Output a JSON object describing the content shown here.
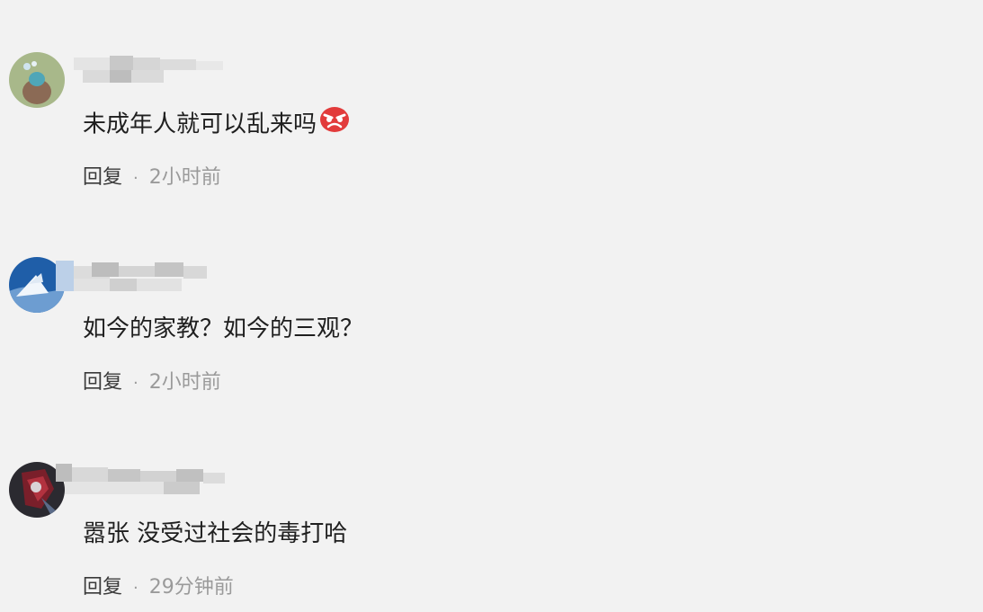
{
  "comments": [
    {
      "text": "未成年人就可以乱来吗",
      "emoji": "angry-face-emoji",
      "reply_label": "回复",
      "separator": "·",
      "time": "2小时前"
    },
    {
      "text": "如今的家教？如今的三观？",
      "reply_label": "回复",
      "separator": "·",
      "time": "2小时前"
    },
    {
      "text": "嚣张 没受过社会的毒打哈",
      "reply_label": "回复",
      "separator": "·",
      "time": "29分钟前"
    }
  ],
  "colors": {
    "background": "#f2f2f2",
    "text": "#1f1f1f",
    "muted": "#9a9a9a",
    "emoji_red": "#e23b3b"
  }
}
